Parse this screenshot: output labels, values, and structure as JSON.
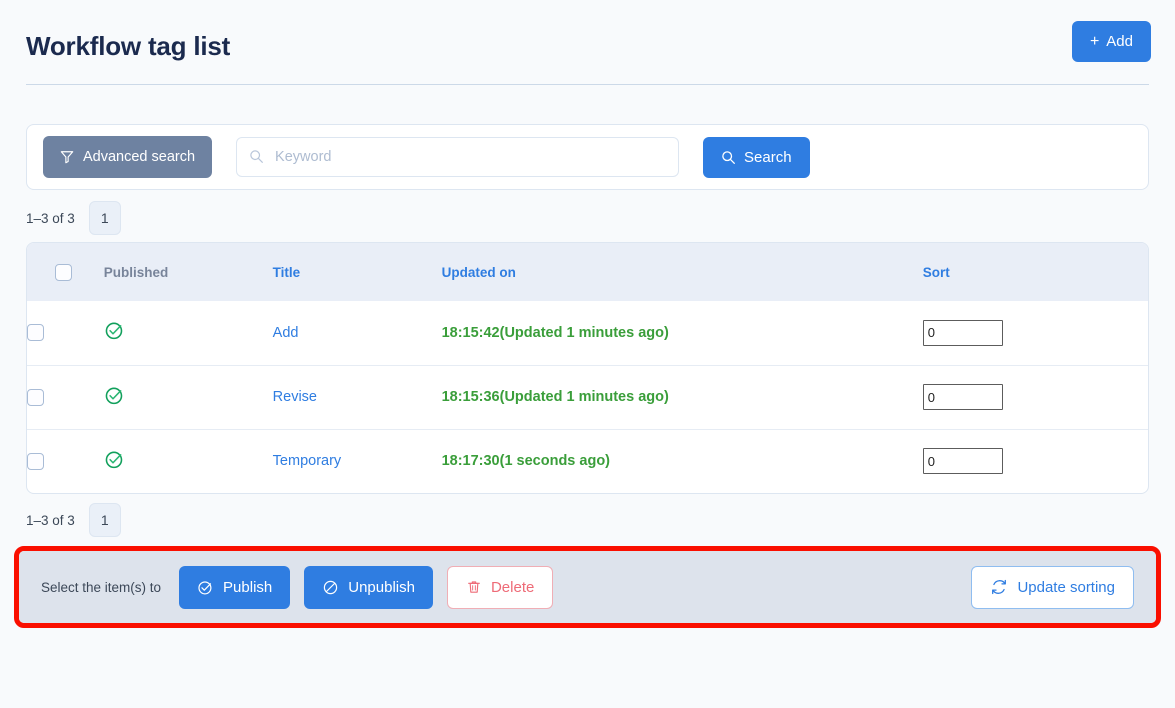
{
  "header": {
    "title": "Workflow tag list",
    "add_label": "Add",
    "add_plus": "+"
  },
  "search": {
    "advanced_label": "Advanced search",
    "keyword_value": "",
    "keyword_placeholder": "Keyword",
    "search_label": "Search"
  },
  "pagination": {
    "range_text": "1–3 of 3",
    "current_page": "1"
  },
  "table": {
    "columns": {
      "published": "Published",
      "title": "Title",
      "updated_on": "Updated on",
      "sort": "Sort"
    },
    "rows": [
      {
        "published_state": "published",
        "title": "Add",
        "updated_on": "18:15:42(Updated 1 minutes ago)",
        "sort_value": "0"
      },
      {
        "published_state": "published",
        "title": "Revise",
        "updated_on": "18:15:36(Updated 1 minutes ago)",
        "sort_value": "0"
      },
      {
        "published_state": "published",
        "title": "Temporary",
        "updated_on": "18:17:30(1 seconds ago)",
        "sort_value": "0"
      }
    ]
  },
  "actions": {
    "select_label": "Select the item(s) to",
    "publish_label": "Publish",
    "unpublish_label": "Unpublish",
    "delete_label": "Delete",
    "update_sorting_label": "Update sorting"
  },
  "colors": {
    "primary_blue": "#2f7de1",
    "advanced_gray": "#6e82a1",
    "published_green": "#16a34a",
    "updated_green": "#3a9e3a",
    "danger_red": "#ee6b77",
    "highlight_red": "#fa0f00",
    "page_bg": "#f8fafc",
    "table_header_bg": "#e9eef7",
    "action_bar_bg": "#dde3ec"
  }
}
